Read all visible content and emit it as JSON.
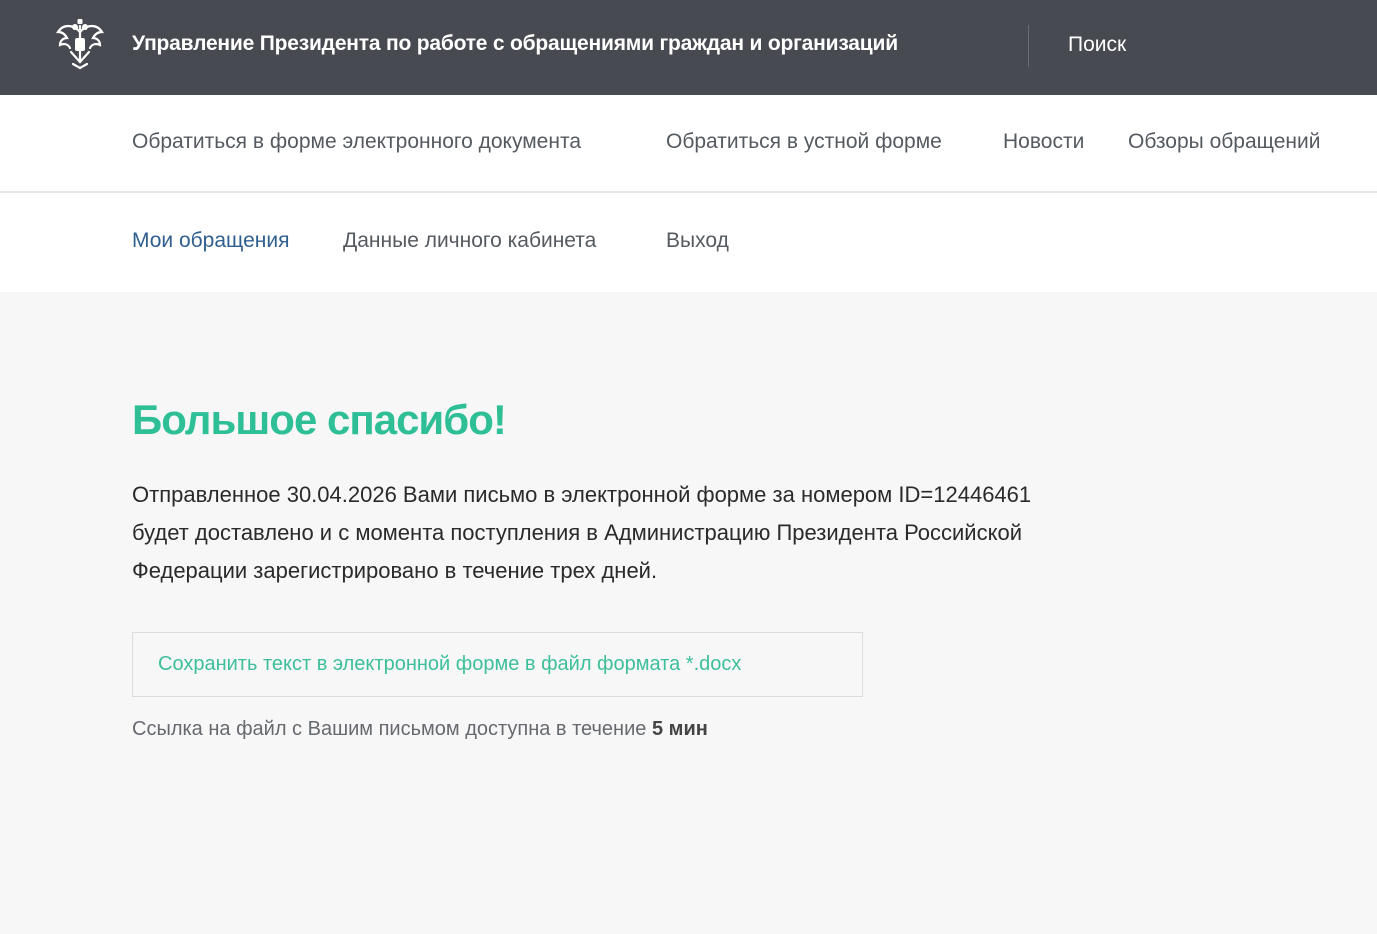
{
  "header": {
    "emblem_icon": "double-headed-eagle-icon",
    "org_title": "Управление Президента по работе с обращениями граждан и организаций",
    "search_label": "Поиск"
  },
  "main_nav": {
    "items": [
      {
        "label": "Обратиться в форме электронного документа"
      },
      {
        "label": "Обратиться в устной форме"
      },
      {
        "label": "Новости"
      },
      {
        "label": "Обзоры обращений"
      }
    ]
  },
  "sub_nav": {
    "items": [
      {
        "label": "Мои обращения",
        "active": true
      },
      {
        "label": "Данные личного кабинета"
      },
      {
        "label": "Выход"
      }
    ]
  },
  "main": {
    "headline": "Большое спасибо!",
    "message_lines": [
      "Отправленное 30.04.2026 Вами письмо в электронной форме за номером ID=12446461",
      "будет доставлено и с момента поступления в Администрацию Президента Российской",
      "Федерации зарегистрировано в течение трех дней."
    ],
    "save_button_label": "Сохранить текст в электронной форме в файл формата *.docx",
    "note_text": "Ссылка на файл с Вашим письмом доступна в течение",
    "note_value": "5 мин"
  },
  "colors": {
    "header_bg": "#484a51",
    "accent_green": "#2fbf96",
    "active_link": "#2f5f8f",
    "page_bg": "#f7f7f7"
  }
}
